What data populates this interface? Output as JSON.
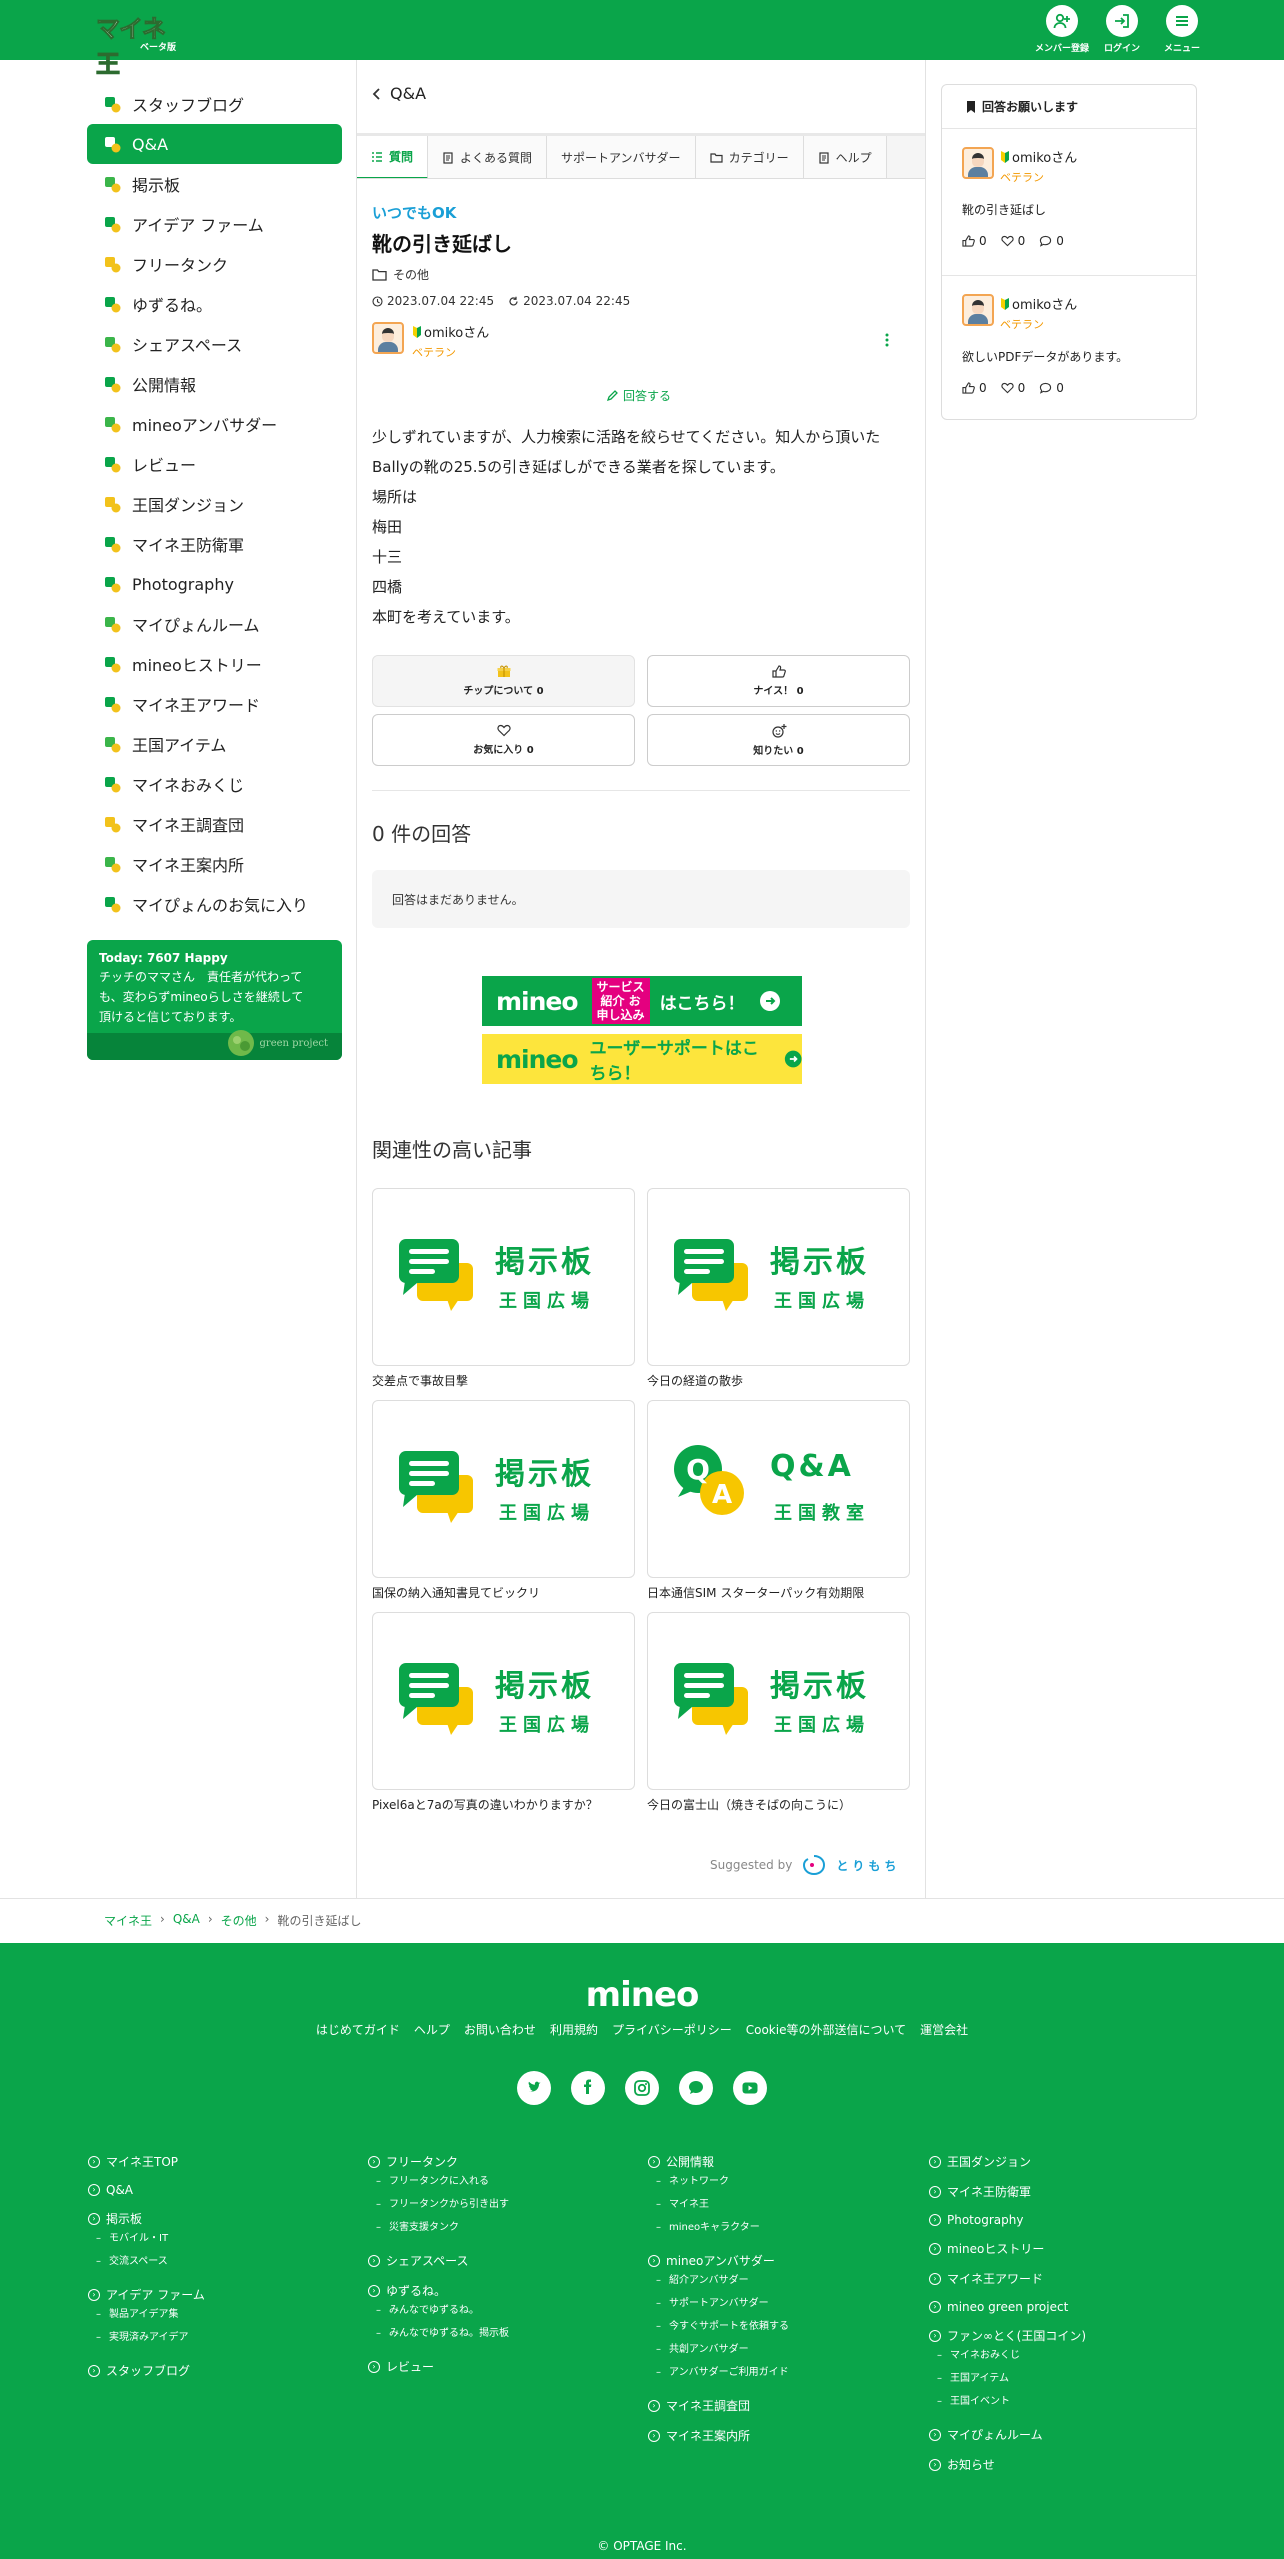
{
  "header": {
    "logo": "マイネ王",
    "logo_sub": "ベータ版",
    "buttons": [
      {
        "label": "メンバー登録",
        "icon": "user-plus-icon"
      },
      {
        "label": "ログイン",
        "icon": "login-icon"
      },
      {
        "label": "メニュー",
        "icon": "menu-icon"
      }
    ]
  },
  "sidebar": {
    "items": [
      {
        "label": "スタッフブログ",
        "icon": "staff-blog-icon",
        "active": false
      },
      {
        "label": "Q&A",
        "icon": "qa-icon",
        "active": true
      },
      {
        "label": "掲示板",
        "icon": "board-icon",
        "active": false
      },
      {
        "label": "アイデア ファーム",
        "icon": "idea-icon",
        "active": false
      },
      {
        "label": "フリータンク",
        "icon": "free-tank-icon",
        "active": false
      },
      {
        "label": "ゆずるね。",
        "icon": "yuzurune-icon",
        "active": false
      },
      {
        "label": "シェアスペース",
        "icon": "share-space-icon",
        "active": false
      },
      {
        "label": "公開情報",
        "icon": "public-info-icon",
        "active": false
      },
      {
        "label": "mineoアンバサダー",
        "icon": "ambassador-icon",
        "active": false
      },
      {
        "label": "レビュー",
        "icon": "review-icon",
        "active": false
      },
      {
        "label": "王国ダンジョン",
        "icon": "dungeon-icon",
        "active": false
      },
      {
        "label": "マイネ王防衛軍",
        "icon": "defense-icon",
        "active": false
      },
      {
        "label": "Photography",
        "icon": "camera-icon",
        "active": false
      },
      {
        "label": "マイぴょんルーム",
        "icon": "maipyon-room-icon",
        "active": false
      },
      {
        "label": "mineoヒストリー",
        "icon": "history-icon",
        "active": false
      },
      {
        "label": "マイネ王アワード",
        "icon": "trophy-icon",
        "active": false
      },
      {
        "label": "王国アイテム",
        "icon": "item-icon",
        "active": false
      },
      {
        "label": "マイネおみくじ",
        "icon": "omikuji-icon",
        "active": false
      },
      {
        "label": "マイネ王調査団",
        "icon": "survey-icon",
        "active": false
      },
      {
        "label": "マイネ王案内所",
        "icon": "guide-icon",
        "active": false
      },
      {
        "label": "マイぴょんのお気に入り",
        "icon": "favorite-icon",
        "active": false
      }
    ],
    "happy": {
      "title": "Today: 7607 Happy",
      "text": "チッチのママさん　責任者が代わっても、変わらずmineoらしさを継続して頂けると信じております。",
      "badge": "green project"
    }
  },
  "main": {
    "back_label": "Q&A",
    "tabs": [
      {
        "label": "質問",
        "active": true
      },
      {
        "label": "よくある質問"
      },
      {
        "label": "サポートアンバサダー"
      },
      {
        "label": "カテゴリー"
      },
      {
        "label": "ヘルプ"
      }
    ],
    "status": "いつでもOK",
    "title": "靴の引き延ばし",
    "category": "その他",
    "posted": "2023.07.04 22:45",
    "updated": "2023.07.04 22:45",
    "user": {
      "name": "omikoさん",
      "rank": "ベテラン"
    },
    "answer_label": "回答する",
    "body": [
      "少しずれていますが、人力検索に活路を絞らせてください。知人から頂いたBallyの靴の25.5の引き延ばしができる業者を探しています。",
      "場所は",
      "梅田",
      "十三",
      "四橋",
      "本町を考えています。"
    ],
    "reactions": {
      "tip": "チップについて 0",
      "nice": "ナイス！ 0",
      "favorite": "お気に入り 0",
      "want": "知りたい 0"
    },
    "answer_count": "0 件の回答",
    "no_answers": "回答はまだありません。",
    "banners": {
      "one_logo": "mineo",
      "one_tag": "サービス紹介 お申し込み",
      "one_text": "はこちら！",
      "two_logo": "mineo",
      "two_text": "ユーザーサポートはこちら！"
    },
    "related_title": "関連性の高い記事",
    "related": [
      {
        "title": "交差点で事故目撃",
        "type": "board",
        "big": "掲示板",
        "small": "王国広場"
      },
      {
        "title": "今日の経道の散歩",
        "type": "board",
        "big": "掲示板",
        "small": "王国広場"
      },
      {
        "title": "国保の納入通知書見てビックリ",
        "type": "board",
        "big": "掲示板",
        "small": "王国広場"
      },
      {
        "title": "日本通信SIM スターターパック有効期限",
        "type": "qa",
        "big": "Q&A",
        "small": "王国教室"
      },
      {
        "title": "Pixel6aと7aの写真の違いわかりますか？",
        "type": "board",
        "big": "掲示板",
        "small": "王国広場"
      },
      {
        "title": "今日の富士山（焼きそばの向こうに）",
        "type": "board",
        "big": "掲示板",
        "small": "王国広場"
      }
    ],
    "suggested_by": "Suggested by",
    "suggested_brand": "とりもち"
  },
  "right": {
    "title": "回答お願いします",
    "items": [
      {
        "user": "omikoさん",
        "rank": "ベテラン",
        "title": "靴の引き延ばし",
        "likes": "0",
        "favs": "0",
        "comments": "0"
      },
      {
        "user": "omikoさん",
        "rank": "ベテラン",
        "title": "欲しいPDFデータがあります。",
        "likes": "0",
        "favs": "0",
        "comments": "0"
      }
    ]
  },
  "breadcrumb": [
    "マイネ王",
    "Q&A",
    "その他",
    "靴の引き延ばし"
  ],
  "footer": {
    "logo": "mineo",
    "links": [
      "はじめてガイド",
      "ヘルプ",
      "お問い合わせ",
      "利用規約",
      "プライバシーポリシー",
      "Cookie等の外部送信について",
      "運営会社"
    ],
    "social": [
      "twitter-icon",
      "facebook-icon",
      "instagram-icon",
      "chat-icon",
      "youtube-icon"
    ],
    "cols": [
      [
        {
          "label": "マイネ王TOP",
          "subs": []
        },
        {
          "label": "Q&A",
          "subs": []
        },
        {
          "label": "掲示板",
          "subs": [
            "モバイル・IT",
            "交流スペース"
          ]
        },
        {
          "label": "アイデア ファーム",
          "subs": [
            "製品アイデア集",
            "実現済みアイデア"
          ]
        },
        {
          "label": "スタッフブログ",
          "subs": []
        }
      ],
      [
        {
          "label": "フリータンク",
          "subs": [
            "フリータンクに入れる",
            "フリータンクから引き出す",
            "災害支援タンク"
          ]
        },
        {
          "label": "シェアスペース",
          "subs": []
        },
        {
          "label": "ゆずるね。",
          "subs": [
            "みんなでゆずるね。",
            "みんなでゆずるね。揭示板"
          ]
        },
        {
          "label": "レビュー",
          "subs": []
        }
      ],
      [
        {
          "label": "公開情報",
          "subs": [
            "ネットワーク",
            "マイネ王",
            "mineoキャラクター"
          ]
        },
        {
          "label": "mineoアンバサダー",
          "subs": [
            "紹介アンバサダー",
            "サポートアンバサダー",
            "今すぐサポートを依頼する",
            "共創アンバサダー",
            "アンバサダーご利用ガイド"
          ]
        },
        {
          "label": "マイネ王調査団",
          "subs": []
        },
        {
          "label": "マイネ王案内所",
          "subs": []
        }
      ],
      [
        {
          "label": "王国ダンジョン",
          "subs": []
        },
        {
          "label": "マイネ王防衛軍",
          "subs": []
        },
        {
          "label": "Photography",
          "subs": []
        },
        {
          "label": "mineoヒストリー",
          "subs": []
        },
        {
          "label": "マイネ王アワード",
          "subs": []
        },
        {
          "label": "mineo green project",
          "subs": []
        },
        {
          "label": "ファン∞とく(王国コイン)",
          "subs": [
            "マイネおみくじ",
            "王国アイテム",
            "王国イベント"
          ]
        },
        {
          "label": "マイぴょんルーム",
          "subs": []
        },
        {
          "label": "お知らせ",
          "subs": []
        }
      ]
    ],
    "copyright": "© OPTAGE Inc."
  },
  "colors": {
    "brand": "#0aa54a",
    "accent_blue": "#1a9fd6",
    "rank_orange": "#f39800",
    "banner_yellow": "#fde53c"
  }
}
